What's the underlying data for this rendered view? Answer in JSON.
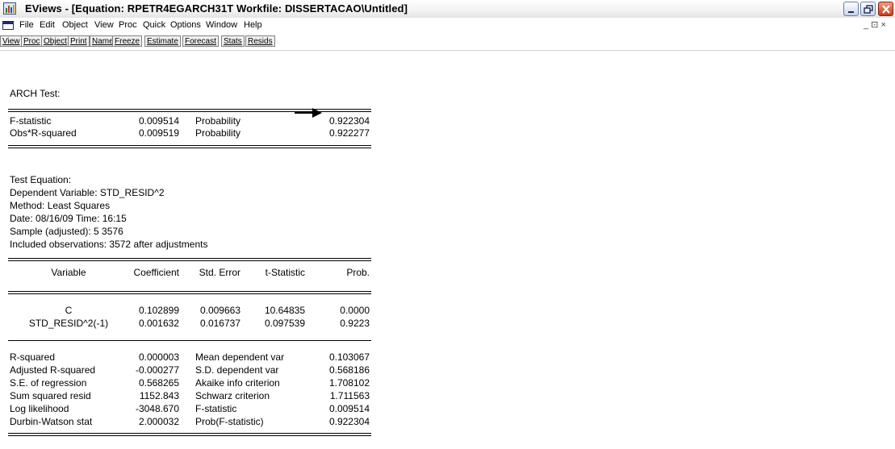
{
  "window": {
    "title": "EViews - [Equation: RPETR4EGARCH31T   Workfile: DISSERTACAO\\Untitled]"
  },
  "menu": {
    "items": [
      "File",
      "Edit",
      "Object",
      "View",
      "Proc",
      "Quick",
      "Options",
      "Window",
      "Help"
    ],
    "mdi_controls": "_ ⊡ ×"
  },
  "toolbar": {
    "buttons": [
      "View",
      "Proc",
      "Object",
      "Print",
      "Name",
      "Freeze",
      "Estimate",
      "Forecast",
      "Stats",
      "Resids"
    ]
  },
  "output": {
    "heading": "ARCH Test:",
    "arch_test": [
      {
        "label": "F-statistic",
        "value": "0.009514",
        "prob_label": "Probability",
        "prob": "0.922304"
      },
      {
        "label": "Obs*R-squared",
        "value": "0.009519",
        "prob_label": "Probability",
        "prob": "0.922277"
      }
    ],
    "test_equation": {
      "title": "Test Equation:",
      "dependent": "Dependent Variable: STD_RESID^2",
      "method": "Method: Least Squares",
      "date": "Date: 08/16/09   Time: 16:15",
      "sample": "Sample (adjusted): 5 3576",
      "observations": "Included observations: 3572 after adjustments"
    },
    "coef_headers": [
      "Variable",
      "Coefficient",
      "Std. Error",
      "t-Statistic",
      "Prob."
    ],
    "coef_rows": [
      [
        "C",
        "0.102899",
        "0.009663",
        "10.64835",
        "0.0000"
      ],
      [
        "STD_RESID^2(-1)",
        "0.001632",
        "0.016737",
        "0.097539",
        "0.9223"
      ]
    ],
    "stats_rows": [
      [
        "R-squared",
        "0.000003",
        "Mean dependent var",
        "0.103067"
      ],
      [
        "Adjusted R-squared",
        "-0.000277",
        "S.D. dependent var",
        "0.568186"
      ],
      [
        "S.E. of regression",
        "0.568265",
        "Akaike info criterion",
        "1.708102"
      ],
      [
        "Sum squared resid",
        "1152.843",
        "Schwarz criterion",
        "1.711563"
      ],
      [
        "Log likelihood",
        "-3048.670",
        "F-statistic",
        "0.009514"
      ],
      [
        "Durbin-Watson stat",
        "2.000032",
        "Prob(F-statistic)",
        "0.922304"
      ]
    ]
  }
}
